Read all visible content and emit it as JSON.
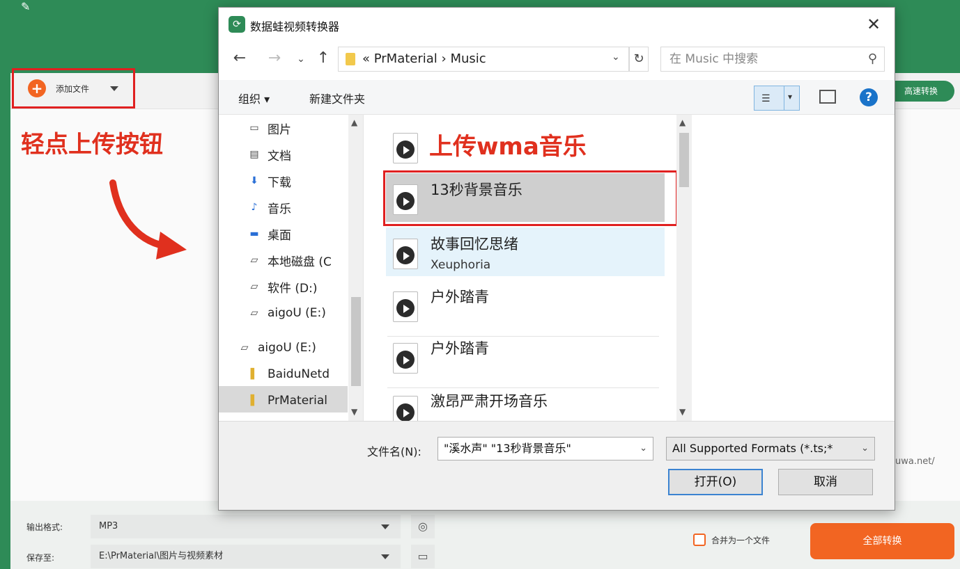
{
  "app": {
    "add_file_label": "添加文件",
    "hint_text": "轻点上传按钮",
    "fast_convert_label": "高速转换",
    "url_fragment": "uwa.net/",
    "output_format_label": "输出格式:",
    "output_format_value": "MP3",
    "save_to_label": "保存至:",
    "save_to_value": "E:\\PrMaterial\\图片与视频素材",
    "merge_label": "合并为一个文件",
    "convert_all_label": "全部转换"
  },
  "dialog": {
    "title": "数据蛙视频转换器",
    "address": "«  PrMaterial  ›  Music",
    "search_placeholder": "在 Music 中搜索",
    "organize_label": "组织 ▾",
    "new_folder_label": "新建文件夹",
    "nav_items": [
      {
        "label": "图片",
        "icon": "pictures-icon"
      },
      {
        "label": "文档",
        "icon": "documents-icon"
      },
      {
        "label": "下载",
        "icon": "downloads-icon"
      },
      {
        "label": "音乐",
        "icon": "music-icon"
      },
      {
        "label": "桌面",
        "icon": "desktop-icon"
      },
      {
        "label": "本地磁盘 (C",
        "icon": "drive-icon"
      },
      {
        "label": "软件 (D:)",
        "icon": "drive-icon"
      },
      {
        "label": "aigoU (E:)",
        "icon": "drive-icon"
      },
      {
        "label": "aigoU (E:)",
        "icon": "drive-icon"
      },
      {
        "label": "BaiduNetd",
        "icon": "folder-icon"
      },
      {
        "label": "PrMaterial",
        "icon": "folder-icon"
      }
    ],
    "annotation": "上传wma音乐",
    "files": [
      {
        "name": "13秒背景音乐",
        "sub": ""
      },
      {
        "name": "故事回忆思绪",
        "sub": "Xeuphoria"
      },
      {
        "name": "户外踏青",
        "sub": ""
      },
      {
        "name": "户外踏青",
        "sub": ""
      },
      {
        "name": "激昂严肃开场音乐",
        "sub": ""
      }
    ],
    "filename_label": "文件名(N):",
    "filename_value": "\"溪水声\" \"13秒背景音乐\"",
    "filetype_value": "All Supported Formats (*.ts;*",
    "open_label": "打开(O)",
    "cancel_label": "取消"
  },
  "colors": {
    "brand_green": "#2e8b57",
    "accent_orange": "#f26522",
    "annotation_red": "#e0301e"
  }
}
